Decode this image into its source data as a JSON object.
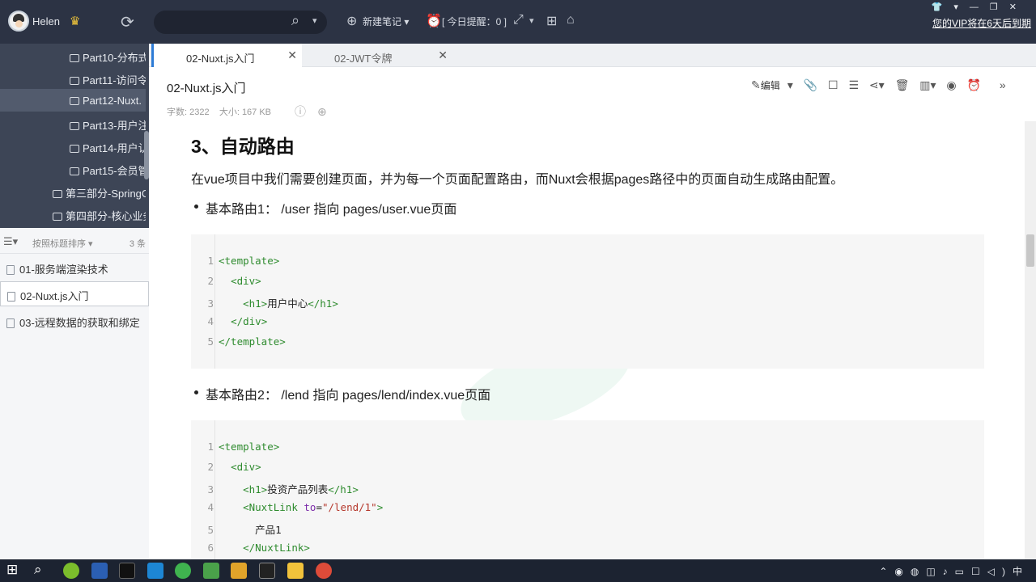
{
  "topbar": {
    "username": "Helen",
    "new_note": "新建笔记",
    "reminder": "[ 今日提醒：0 ]",
    "vip_notice": "您的VIP将在6天后到期",
    "icons": [
      "avatar",
      "crown-icon",
      "sync-icon",
      "search-icon",
      "plus-circle-icon",
      "alarm-icon",
      "expand-icon",
      "grid-icon",
      "home-icon"
    ]
  },
  "sidebar": {
    "tree": [
      {
        "label": "Part10-分布式",
        "indent": 2
      },
      {
        "label": "Part11-访问令",
        "indent": 2
      },
      {
        "label": "Part12-Nuxt.",
        "indent": 2,
        "active": true
      },
      {
        "label": "Part13-用户注",
        "indent": 2
      },
      {
        "label": "Part14-用户认",
        "indent": 2
      },
      {
        "label": "Part15-会员管",
        "indent": 2
      },
      {
        "label": "第三部分-SpringC",
        "indent": 1
      },
      {
        "label": "第四部分-核心业务",
        "indent": 1
      }
    ],
    "sort_label": "按照标题排序",
    "count": "3 条",
    "notes": [
      {
        "label": "01-服务端渲染技术"
      },
      {
        "label": "02-Nuxt.js入门",
        "active": true
      },
      {
        "label": "03-远程数据的获取和绑定"
      }
    ]
  },
  "tabs": [
    {
      "label": "02-Nuxt.js入门",
      "active": true
    },
    {
      "label": "02-JWT令牌",
      "active": false
    }
  ],
  "doc": {
    "title": "02-Nuxt.js入门",
    "word_count": "字数: 2322",
    "size": "大小: 167 KB",
    "edit_label": "编辑"
  },
  "content": {
    "heading": "3、自动路由",
    "paragraph": "在vue项目中我们需要创建页面，并为每一个页面配置路由，而Nuxt会根据pages路径中的页面自动生成路由配置。",
    "bullet1": "基本路由1： /user 指向 pages/user.vue页面",
    "bullet2": "基本路由2： /lend 指向 pages/lend/index.vue页面",
    "code1": [
      {
        "n": "1",
        "parts": [
          [
            "tag",
            "<template>"
          ]
        ]
      },
      {
        "n": "2",
        "parts": [
          [
            "txt",
            "  "
          ],
          [
            "tag",
            "<div>"
          ]
        ]
      },
      {
        "n": "3",
        "parts": [
          [
            "txt",
            "    "
          ],
          [
            "tag",
            "<h1>"
          ],
          [
            "txt",
            "用户中心"
          ],
          [
            "tag",
            "</h1>"
          ]
        ]
      },
      {
        "n": "4",
        "parts": [
          [
            "txt",
            "  "
          ],
          [
            "tag",
            "</div>"
          ]
        ]
      },
      {
        "n": "5",
        "parts": [
          [
            "tag",
            "</template>"
          ]
        ]
      }
    ],
    "code2": [
      {
        "n": "1",
        "parts": [
          [
            "tag",
            "<template>"
          ]
        ]
      },
      {
        "n": "2",
        "parts": [
          [
            "txt",
            "  "
          ],
          [
            "tag",
            "<div>"
          ]
        ]
      },
      {
        "n": "3",
        "parts": [
          [
            "txt",
            "    "
          ],
          [
            "tag",
            "<h1>"
          ],
          [
            "txt",
            "投资产品列表"
          ],
          [
            "tag",
            "</h1>"
          ]
        ]
      },
      {
        "n": "4",
        "parts": [
          [
            "txt",
            "    "
          ],
          [
            "tag",
            "<NuxtLink "
          ],
          [
            "attr",
            "to"
          ],
          [
            "txt",
            "="
          ],
          [
            "str",
            "\"/lend/1\""
          ],
          [
            "tag",
            ">"
          ]
        ]
      },
      {
        "n": "5",
        "parts": [
          [
            "txt",
            "      产品1"
          ]
        ]
      },
      {
        "n": "6",
        "parts": [
          [
            "txt",
            "    "
          ],
          [
            "tag",
            "</NuxtLink>"
          ]
        ]
      }
    ]
  },
  "taskbar": {
    "apps": [
      "start-icon",
      "search-icon",
      "app-green-icon",
      "word-icon",
      "ide-icon",
      "vscode-icon",
      "wechat-icon",
      "app-typora-icon",
      "app-note-icon",
      "terminal-icon",
      "explorer-icon",
      "chrome-icon"
    ],
    "ime": "中"
  },
  "colors": {
    "topbar": "#2c3344",
    "tree_bg": "#3d4556",
    "accent": "#2d7bd6",
    "code_tag": "#2e8b2e"
  }
}
